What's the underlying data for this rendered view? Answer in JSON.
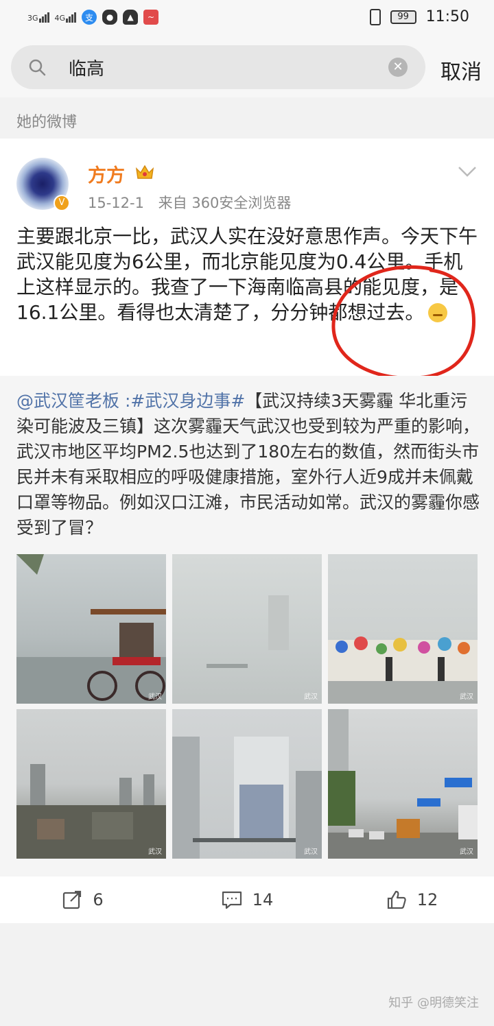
{
  "status_bar": {
    "network_1": "3G",
    "network_2": "4G",
    "battery": "99",
    "time": "11:50"
  },
  "search": {
    "query": "临高",
    "cancel_label": "取消"
  },
  "section_label": "她的微博",
  "post": {
    "author": "方方",
    "date": "15-12-1",
    "source": "来自 360安全浏览器",
    "text": "主要跟北京一比，武汉人实在没好意思作声。今天下午武汉能见度为6公里，而北京能见度为0.4公里。手机上这样显示的。我查了一下海南临高县的能见度，是16.1公里。看得也太清楚了，分分钟都想过去。"
  },
  "repost": {
    "mention": "@武汉筐老板",
    "topic": ":#武汉身边事#",
    "text": "【武汉持续3天雾霾 华北重污染可能波及三镇】这次雾霾天气武汉也受到较为严重的影响，武汉市地区平均PM2.5也达到了180左右的数值，然而街头市民并未有采取相应的呼吸健康措施，室外行人近9成并未佩戴口罩等物品。例如汉口江滩，市民活动如常。武汉的雾霾你感受到了冒？"
  },
  "actions": {
    "repost_count": "6",
    "comment_count": "14",
    "like_count": "12"
  },
  "watermark": "知乎 @明德笑注",
  "colors": {
    "author": "#f07b1f",
    "link": "#5173a8",
    "annotation": "#e0261b"
  }
}
